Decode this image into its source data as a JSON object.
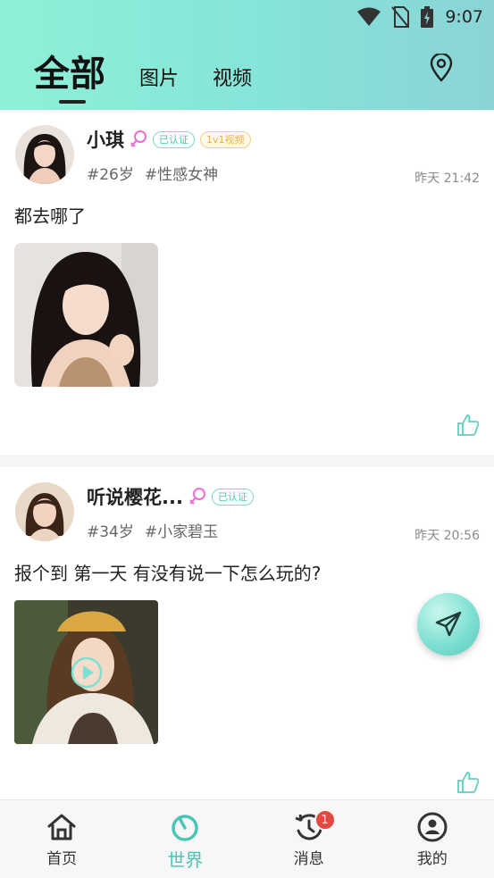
{
  "status": {
    "time": "9:07"
  },
  "tabs": [
    {
      "label": "全部",
      "active": true
    },
    {
      "label": "图片",
      "active": false
    },
    {
      "label": "视频",
      "active": false
    }
  ],
  "posts": [
    {
      "name": "小琪",
      "gender_icon": "female-icon",
      "badges": [
        "已认证",
        "1v1视频"
      ],
      "tags": [
        "#26岁",
        "#性感女神"
      ],
      "time": "昨天 21:42",
      "text": "都去哪了",
      "media": "photo"
    },
    {
      "name": "听说樱花...",
      "gender_icon": "female-icon",
      "badges": [
        "已认证"
      ],
      "tags": [
        "#34岁",
        "#小家碧玉"
      ],
      "time": "昨天 20:56",
      "text": "报个到 第一天 有没有说一下怎么玩的?",
      "media": "video"
    }
  ],
  "nav": [
    {
      "label": "首页",
      "icon": "home-icon"
    },
    {
      "label": "世界",
      "icon": "world-icon",
      "active": true
    },
    {
      "label": "消息",
      "icon": "message-history-icon",
      "badge": "1"
    },
    {
      "label": "我的",
      "icon": "profile-icon"
    }
  ],
  "colors": {
    "accent": "#4cc6b4",
    "header_start": "#8ff0d8",
    "header_end": "#8ad4d6",
    "badge_red": "#e24a3f"
  }
}
